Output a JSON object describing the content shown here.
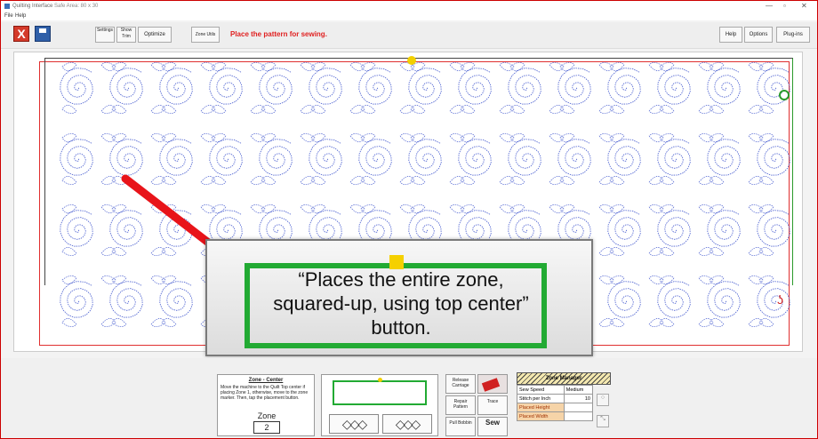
{
  "titlebar": {
    "title": "Quilting Interface",
    "safe_area": "Safe Area: 80 x 30",
    "min": "—",
    "max": "▫",
    "close": "✕"
  },
  "menu": {
    "file": "File",
    "help": "Help"
  },
  "toolbar": {
    "close_label": "X",
    "settings_label": "Settings",
    "show_trim_label": "Show Trim",
    "optimize_label": "Optimize",
    "zone_utils_label": "Zone Utils",
    "status_text": "Place the pattern for sewing.",
    "help_label": "Help",
    "options_label": "Options",
    "plugins_label": "Plug-ins"
  },
  "callout": {
    "caption_line1": "“Places the entire zone,",
    "caption_line2": "squared-up, using top center”",
    "caption_line3": "button."
  },
  "zone_info": {
    "title": "Zone - Center",
    "description": "Move the machine to the Quilt Top center if placing Zone 1, otherwise, move to the zone marker. Then, tap the placement button.",
    "zone_label": "Zone",
    "zone_value": "2"
  },
  "placement": {
    "btn_left": "◇◇◇",
    "btn_right": "◇◇◇"
  },
  "tools": {
    "release_carriage": "Release Carriage",
    "repair_pattern": "Repair Pattern",
    "trace": "Trace",
    "pull_bobbin": "Pull Bobbin",
    "sew": "Sew"
  },
  "zone_manager": {
    "title": "Zone Manager",
    "rows": [
      {
        "label": "Sew Speed",
        "value": "Medium"
      },
      {
        "label": "Stitch per Inch",
        "value": "10"
      },
      {
        "label": "Placed Height",
        "value": ""
      },
      {
        "label": "Placed Width",
        "value": ""
      }
    ]
  },
  "colors": {
    "accent_red": "#e02020",
    "zone_green": "#22aa33",
    "marker_yellow": "#f2d000",
    "stitch_blue": "#4a5fd0"
  }
}
